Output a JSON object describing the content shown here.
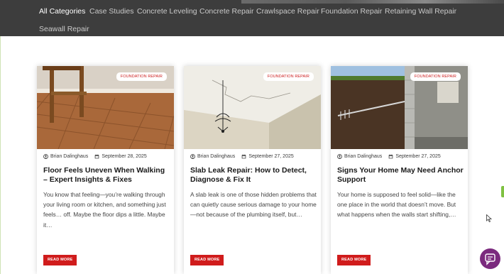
{
  "nav": {
    "categories": [
      "All Categories",
      "Case Studies",
      "Concrete Leveling",
      "Concrete Repair",
      "Crawlspace Repair",
      "Foundation Repair",
      "Retaining Wall Repair",
      "Seawall Repair"
    ]
  },
  "posts": [
    {
      "badge": "FOUNDATION REPAIR",
      "author": "Brian Dalinghaus",
      "date": "September 28, 2025",
      "title": "Floor Feels Uneven When Walking – Expert Insights & Fixes",
      "excerpt": "You know that feeling—you’re walking through your living room or kitchen, and something just feels… off. Maybe the floor dips a little. Maybe it…",
      "button": "READ MORE"
    },
    {
      "badge": "FOUNDATION REPAIR",
      "author": "Brian Dalinghaus",
      "date": "September 27, 2025",
      "title": "Slab Leak Repair: How to Detect, Diagnose & Fix It",
      "excerpt": "A slab leak is one of those hidden problems that can quietly cause serious damage to your home—not because of the plumbing itself, but…",
      "button": "READ MORE"
    },
    {
      "badge": "FOUNDATION REPAIR",
      "author": "Brian Dalinghaus",
      "date": "September 27, 2025",
      "title": "Signs Your Home May Need Anchor Support",
      "excerpt": "Your home is supposed to feel solid—like the one place in the world that doesn’t move. But what happens when the walls start shifting,…",
      "button": "READ MORE"
    }
  ],
  "colors": {
    "accent": "#d01c1c",
    "nav_bg": "#3d3d3d",
    "chat": "#7b2a7e"
  },
  "icons": {
    "author": "user-circle-icon",
    "date": "calendar-icon",
    "chat": "chat-bubble-icon",
    "cursor": "mouse-pointer-icon"
  }
}
